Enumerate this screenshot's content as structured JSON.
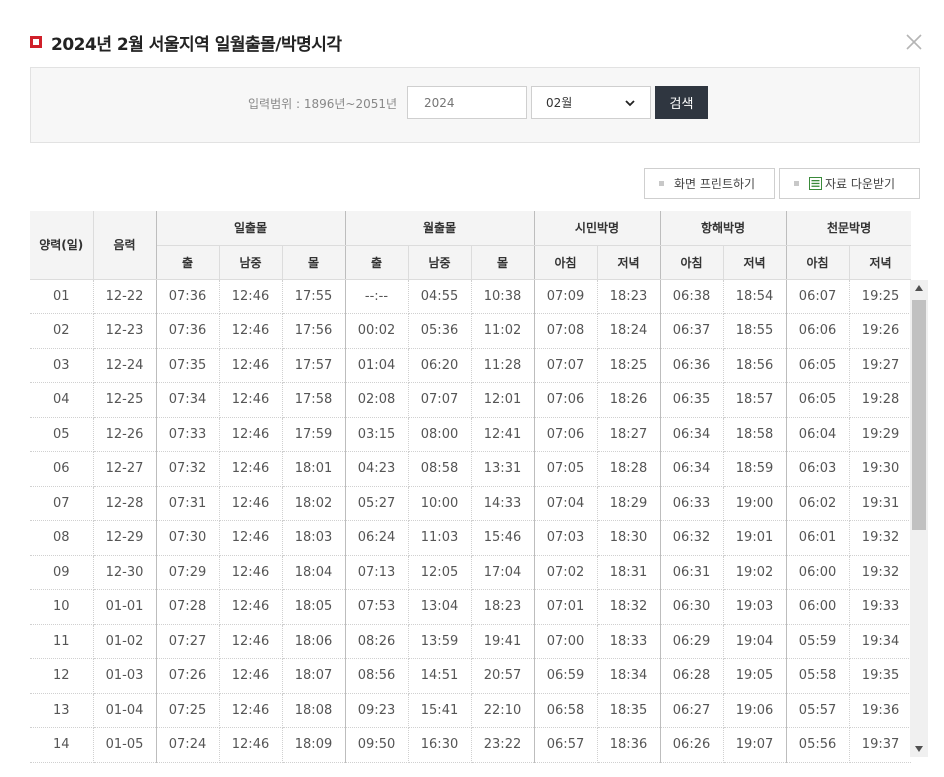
{
  "header": {
    "title": "2024년 2월 서울지역 일월출몰/박명시각"
  },
  "search": {
    "range_label": "입력범위 : 1896년~2051년",
    "year_placeholder": "2024",
    "month_value": "02월",
    "search_label": "검색"
  },
  "actions": {
    "print_label": "화면 프린트하기",
    "download_label": "자료 다운받기"
  },
  "table": {
    "col_day": "양력(일)",
    "col_lunar": "음력",
    "groups": [
      "일출몰",
      "월출몰",
      "시민박명",
      "항해박명",
      "천문박명"
    ],
    "sub": {
      "rise": "출",
      "transit": "남중",
      "set": "몰",
      "morning": "아침",
      "evening": "저녁"
    },
    "rows": [
      [
        "01",
        "12-22",
        "07:36",
        "12:46",
        "17:55",
        "--:--",
        "04:55",
        "10:38",
        "07:09",
        "18:23",
        "06:38",
        "18:54",
        "06:07",
        "19:25"
      ],
      [
        "02",
        "12-23",
        "07:36",
        "12:46",
        "17:56",
        "00:02",
        "05:36",
        "11:02",
        "07:08",
        "18:24",
        "06:37",
        "18:55",
        "06:06",
        "19:26"
      ],
      [
        "03",
        "12-24",
        "07:35",
        "12:46",
        "17:57",
        "01:04",
        "06:20",
        "11:28",
        "07:07",
        "18:25",
        "06:36",
        "18:56",
        "06:05",
        "19:27"
      ],
      [
        "04",
        "12-25",
        "07:34",
        "12:46",
        "17:58",
        "02:08",
        "07:07",
        "12:01",
        "07:06",
        "18:26",
        "06:35",
        "18:57",
        "06:05",
        "19:28"
      ],
      [
        "05",
        "12-26",
        "07:33",
        "12:46",
        "17:59",
        "03:15",
        "08:00",
        "12:41",
        "07:06",
        "18:27",
        "06:34",
        "18:58",
        "06:04",
        "19:29"
      ],
      [
        "06",
        "12-27",
        "07:32",
        "12:46",
        "18:01",
        "04:23",
        "08:58",
        "13:31",
        "07:05",
        "18:28",
        "06:34",
        "18:59",
        "06:03",
        "19:30"
      ],
      [
        "07",
        "12-28",
        "07:31",
        "12:46",
        "18:02",
        "05:27",
        "10:00",
        "14:33",
        "07:04",
        "18:29",
        "06:33",
        "19:00",
        "06:02",
        "19:31"
      ],
      [
        "08",
        "12-29",
        "07:30",
        "12:46",
        "18:03",
        "06:24",
        "11:03",
        "15:46",
        "07:03",
        "18:30",
        "06:32",
        "19:01",
        "06:01",
        "19:32"
      ],
      [
        "09",
        "12-30",
        "07:29",
        "12:46",
        "18:04",
        "07:13",
        "12:05",
        "17:04",
        "07:02",
        "18:31",
        "06:31",
        "19:02",
        "06:00",
        "19:32"
      ],
      [
        "10",
        "01-01",
        "07:28",
        "12:46",
        "18:05",
        "07:53",
        "13:04",
        "18:23",
        "07:01",
        "18:32",
        "06:30",
        "19:03",
        "06:00",
        "19:33"
      ],
      [
        "11",
        "01-02",
        "07:27",
        "12:46",
        "18:06",
        "08:26",
        "13:59",
        "19:41",
        "07:00",
        "18:33",
        "06:29",
        "19:04",
        "05:59",
        "19:34"
      ],
      [
        "12",
        "01-03",
        "07:26",
        "12:46",
        "18:07",
        "08:56",
        "14:51",
        "20:57",
        "06:59",
        "18:34",
        "06:28",
        "19:05",
        "05:58",
        "19:35"
      ],
      [
        "13",
        "01-04",
        "07:25",
        "12:46",
        "18:08",
        "09:23",
        "15:41",
        "22:10",
        "06:58",
        "18:35",
        "06:27",
        "19:06",
        "05:57",
        "19:36"
      ],
      [
        "14",
        "01-05",
        "07:24",
        "12:46",
        "18:09",
        "09:50",
        "16:30",
        "23:22",
        "06:57",
        "18:36",
        "06:26",
        "19:07",
        "05:56",
        "19:37"
      ]
    ]
  },
  "colors": {
    "title_mark": "#d0202a",
    "search_button": "#2f3640",
    "header_bg": "#f4f4f4"
  },
  "icons": {
    "close": "close-icon",
    "select_arrow": "chevron-down-icon",
    "excel": "excel-icon",
    "bullet": "square-bullet-icon"
  }
}
